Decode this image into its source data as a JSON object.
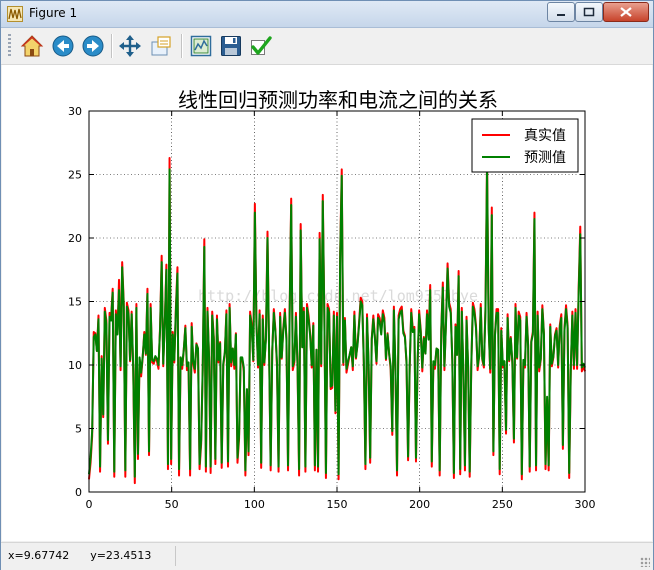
{
  "window": {
    "title": "Figure 1"
  },
  "toolbar": {
    "items": [
      {
        "name": "home-icon",
        "label": "Home"
      },
      {
        "name": "back-icon",
        "label": "Back"
      },
      {
        "name": "forward-icon",
        "label": "Forward"
      },
      {
        "name": "pan-icon",
        "label": "Pan"
      },
      {
        "name": "zoom-icon",
        "label": "Zoom"
      },
      {
        "name": "subplots-icon",
        "label": "Configure subplots"
      },
      {
        "name": "save-icon",
        "label": "Save"
      },
      {
        "name": "edit-icon",
        "label": "Edit"
      }
    ]
  },
  "status": {
    "coords": "x=9.67742      y=23.4513"
  },
  "watermark": "http://blog.csdn.net/lom9357bye",
  "chart_data": {
    "type": "line",
    "title": "线性回归预测功率和电流之间的关系",
    "xlabel": "",
    "ylabel": "",
    "xlim": [
      0,
      300
    ],
    "ylim": [
      0,
      30
    ],
    "xticks": [
      0,
      50,
      100,
      150,
      200,
      250,
      300
    ],
    "yticks": [
      0,
      5,
      10,
      15,
      20,
      25,
      30
    ],
    "grid": true,
    "legend_position": "top-right",
    "series": [
      {
        "name": "真实值",
        "color": "#ff0000",
        "values": [
          1.0,
          2.3,
          4.4,
          12.6,
          12.5,
          11.1,
          13.9,
          1.6,
          10.7,
          5.9,
          14.5,
          13.5,
          3.8,
          14.1,
          13.8,
          16.0,
          1.2,
          14.3,
          12.5,
          16.7,
          9.6,
          18.1,
          14.9,
          1.2,
          14.9,
          14.3,
          10.3,
          14.2,
          9.5,
          0.7,
          14.8,
          2.6,
          10.5,
          9.1,
          10.6,
          12.6,
          10.8,
          16.0,
          2.9,
          14.8,
          10.2,
          10.1,
          10.6,
          10.3,
          9.7,
          13.0,
          18.6,
          9.9,
          13.5,
          17.9,
          1.8,
          26.3,
          2.2,
          12.6,
          10.2,
          14.5,
          17.7,
          1.3,
          10.6,
          9.7,
          11.2,
          13.1,
          9.6,
          9.9,
          1.3,
          13.3,
          10.1,
          9.4,
          11.7,
          11.3,
          1.8,
          3.8,
          9.6,
          19.9,
          1.6,
          14.5,
          10.6,
          1.5,
          14.2,
          12.2,
          2.2,
          13.9,
          10.2,
          11.8,
          1.9,
          9.9,
          11.0,
          14.3,
          2.0,
          14.8,
          9.9,
          11.3,
          9.7,
          12.5,
          2.3,
          4.2,
          10.5,
          10.5,
          9.5,
          1.3,
          7.9,
          2.9,
          14.2,
          13.2,
          10.3,
          22.7,
          13.4,
          9.8,
          14.3,
          1.9,
          13.9,
          10.0,
          12.2,
          20.5,
          11.2,
          1.7,
          11.1,
          14.4,
          12.8,
          9.9,
          1.6,
          14.1,
          10.5,
          12.9,
          14.4,
          12.1,
          1.7,
          14.1,
          23.1,
          9.6,
          10.2,
          14.1,
          9.9,
          1.3,
          21.1,
          11.4,
          14.5,
          1.6,
          14.8,
          13.9,
          12.5,
          9.8,
          13.3,
          1.7,
          11.2,
          1.6,
          20.4,
          9.9,
          23.4,
          13.9,
          1.1,
          14.8,
          14.4,
          8.1,
          8.2,
          14.2,
          6.2,
          14.1,
          1.0,
          18.8,
          25.4,
          10.0,
          13.7,
          9.4,
          10.1,
          10.8,
          11.4,
          9.6,
          14.2,
          10.5,
          11.7,
          13.4,
          15.3,
          15.0,
          10.0,
          1.8,
          14.0,
          9.9,
          2.3,
          12.1,
          13.9,
          12.2,
          10.1,
          14.0,
          13.7,
          12.6,
          14.3,
          13.7,
          10.4,
          12.5,
          10.9,
          9.6,
          4.5,
          14.6,
          9.4,
          1.3,
          13.9,
          14.4,
          14.6,
          12.7,
          12.3,
          10.1,
          2.5,
          9.6,
          14.4,
          12.8,
          13.0,
          2.4,
          9.9,
          14.3,
          12.8,
          9.5,
          12.2,
          10.9,
          14.3,
          12.1,
          16.3,
          2.0,
          10.1,
          9.7,
          11.3,
          11.2,
          1.3,
          12.8,
          16.5,
          9.6,
          13.4,
          18.0,
          14.9,
          14.4,
          10.3,
          1.1,
          13.2,
          10.8,
          17.4,
          1.4,
          14.5,
          9.3,
          1.7,
          13.8,
          9.8,
          1.2,
          9.8,
          14.9,
          14.4,
          13.1,
          9.6,
          10.7,
          14.8,
          10.4,
          9.8,
          14.6,
          26.2,
          13.1,
          9.4,
          22.4,
          2.9,
          12.4,
          14.4,
          14.4,
          1.4,
          12.9,
          9.8,
          10.1,
          4.6,
          14.0,
          10.3,
          12.2,
          10.1,
          3.9,
          14.8,
          10.5,
          14.2,
          13.8,
          1.0,
          10.2,
          9.8,
          14.1,
          11.6,
          1.6,
          11.9,
          12.6,
          22.0,
          1.7,
          14.2,
          9.5,
          10.4,
          14.7,
          12.5,
          1.8,
          7.3,
          1.7,
          13.2,
          9.9,
          10.6,
          12.4,
          12.9,
          9.8,
          13.1,
          14.0,
          3.4,
          12.9,
          14.7,
          13.1,
          1.1,
          9.5,
          14.2,
          9.7,
          14.4,
          9.7,
          16.1,
          20.9,
          9.5,
          9.9,
          9.5
        ]
      },
      {
        "name": "预测值",
        "color": "#008000",
        "values": [
          1.4,
          2.7,
          4.8,
          12.2,
          12.4,
          11.1,
          13.6,
          2.0,
          10.5,
          6.1,
          14.2,
          13.2,
          4.1,
          13.8,
          13.5,
          15.7,
          1.6,
          14.0,
          12.4,
          15.9,
          9.9,
          17.7,
          14.6,
          1.7,
          14.6,
          14.0,
          10.4,
          14.0,
          9.8,
          1.2,
          14.5,
          3.0,
          10.6,
          9.4,
          10.7,
          12.4,
          10.9,
          15.6,
          3.2,
          14.5,
          10.4,
          10.3,
          10.7,
          10.5,
          10.0,
          12.8,
          18.1,
          10.1,
          13.3,
          17.5,
          2.2,
          25.4,
          2.6,
          12.4,
          10.4,
          14.2,
          17.2,
          1.8,
          10.6,
          10.0,
          11.2,
          12.9,
          9.9,
          10.2,
          1.8,
          13.0,
          10.3,
          9.7,
          11.6,
          11.3,
          2.2,
          4.1,
          9.8,
          19.3,
          2.0,
          14.2,
          10.7,
          2.0,
          13.9,
          12.0,
          2.6,
          13.6,
          10.4,
          11.7,
          2.3,
          10.1,
          11.0,
          14.0,
          2.4,
          14.5,
          10.2,
          11.3,
          10.0,
          12.4,
          2.7,
          4.5,
          10.6,
          10.6,
          9.8,
          1.7,
          8.1,
          3.2,
          13.9,
          12.9,
          10.4,
          22.0,
          13.2,
          10.0,
          14.0,
          2.3,
          13.6,
          10.2,
          12.0,
          20.0,
          11.2,
          2.1,
          11.1,
          14.1,
          12.6,
          10.2,
          2.0,
          13.8,
          10.6,
          12.7,
          14.1,
          12.0,
          2.1,
          13.8,
          22.6,
          9.9,
          10.4,
          13.8,
          10.1,
          1.8,
          20.6,
          11.4,
          14.2,
          2.0,
          14.5,
          13.6,
          12.3,
          10.0,
          13.1,
          2.1,
          11.2,
          2.0,
          19.9,
          10.1,
          22.9,
          13.6,
          1.5,
          14.5,
          14.1,
          8.3,
          8.4,
          13.9,
          6.4,
          13.8,
          1.4,
          18.4,
          24.9,
          10.2,
          13.5,
          9.7,
          10.3,
          10.8,
          11.4,
          9.9,
          13.9,
          10.6,
          11.6,
          13.2,
          15.0,
          14.7,
          10.2,
          2.2,
          13.7,
          10.2,
          2.7,
          12.0,
          13.6,
          12.1,
          10.3,
          13.7,
          13.4,
          12.4,
          14.0,
          13.4,
          10.5,
          12.4,
          10.9,
          9.9,
          4.8,
          14.3,
          9.7,
          1.7,
          13.6,
          14.1,
          14.3,
          12.5,
          12.2,
          10.3,
          2.8,
          9.9,
          14.1,
          12.6,
          12.8,
          2.7,
          10.2,
          14.0,
          12.6,
          9.8,
          12.1,
          10.9,
          14.0,
          12.0,
          15.9,
          2.4,
          10.3,
          10.0,
          11.3,
          11.2,
          1.7,
          12.6,
          16.1,
          9.9,
          13.2,
          17.6,
          14.6,
          14.1,
          10.4,
          1.5,
          13.0,
          10.8,
          17.0,
          1.8,
          14.2,
          9.6,
          2.1,
          13.5,
          10.0,
          1.6,
          10.0,
          14.6,
          14.1,
          12.9,
          9.9,
          10.7,
          14.5,
          10.5,
          10.0,
          14.3,
          25.5,
          12.9,
          9.7,
          21.8,
          3.2,
          12.3,
          14.1,
          14.1,
          1.8,
          12.7,
          10.0,
          10.3,
          4.9,
          13.7,
          10.4,
          12.1,
          10.3,
          4.2,
          14.5,
          10.6,
          13.9,
          13.5,
          1.4,
          10.4,
          10.0,
          13.8,
          11.5,
          2.0,
          11.8,
          12.4,
          21.5,
          2.1,
          13.9,
          9.8,
          10.5,
          14.4,
          12.4,
          2.2,
          7.5,
          2.1,
          13.0,
          10.1,
          10.7,
          12.3,
          12.7,
          10.0,
          12.9,
          13.7,
          3.7,
          12.7,
          14.4,
          12.9,
          1.5,
          9.8,
          13.9,
          10.0,
          14.1,
          10.0,
          15.7,
          20.3,
          9.8,
          10.1,
          9.8
        ]
      }
    ]
  }
}
